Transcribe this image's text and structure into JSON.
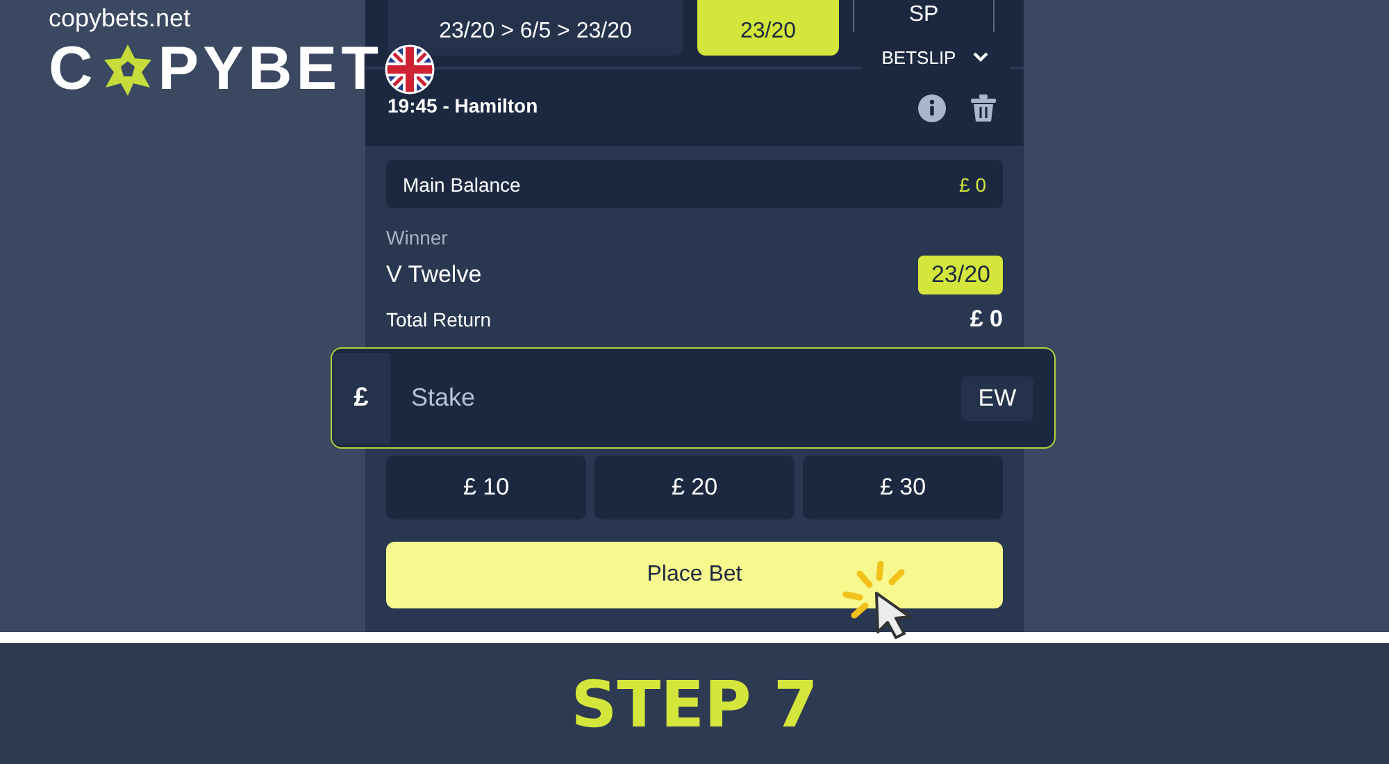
{
  "brand": {
    "site": "copybets.net",
    "logo_start": "C",
    "logo_end": "PYBET"
  },
  "odds_options": [
    {
      "value": "23/20 > 6/5 > 23/20",
      "kind": "history",
      "selected": false
    },
    {
      "value": "23/20",
      "kind": "price",
      "selected": true
    },
    {
      "value": "SP",
      "kind": "price",
      "selected": false
    }
  ],
  "betslip": {
    "label": "BETSLIP",
    "expanded": true
  },
  "race": "19:45 - Hamilton",
  "balance": {
    "label": "Main Balance",
    "amount": "£ 0"
  },
  "market": "Winner",
  "selection": {
    "name": "V Twelve",
    "odds": "23/20"
  },
  "total_return": {
    "label": "Total Return",
    "amount": "£ 0"
  },
  "stake": {
    "currency": "£",
    "placeholder": "Stake",
    "each_way": "EW",
    "focused": true
  },
  "quick_stakes": [
    "£ 10",
    "£ 20",
    "£ 30"
  ],
  "place_bet": "Place Bet",
  "step": "STEP 7"
}
